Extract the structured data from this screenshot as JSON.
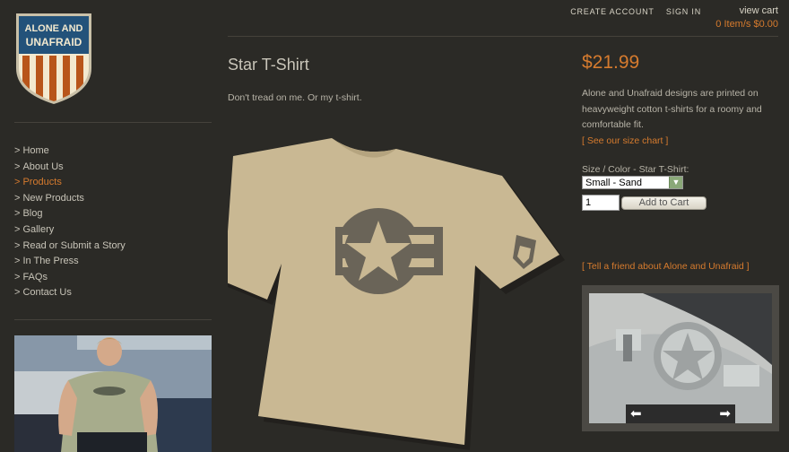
{
  "header": {
    "create_account": "CREATE ACCOUNT",
    "sign_in": "SIGN IN",
    "view_cart": "view cart",
    "cart_summary": "0 Item/s $0.00"
  },
  "logo": {
    "line1": "ALONE AND",
    "line2": "UNAFRAID",
    "colors": {
      "blue": "#23527a",
      "orange": "#b8551a",
      "cream": "#f3e9cf"
    }
  },
  "nav": [
    {
      "label": "Home",
      "active": false
    },
    {
      "label": "About Us",
      "active": false
    },
    {
      "label": "Products",
      "active": true
    },
    {
      "label": "New Products",
      "active": false
    },
    {
      "label": "Blog",
      "active": false
    },
    {
      "label": "Gallery",
      "active": false
    },
    {
      "label": "Read or Submit a Story",
      "active": false
    },
    {
      "label": "In The Press",
      "active": false
    },
    {
      "label": "FAQs",
      "active": false
    },
    {
      "label": "Contact Us",
      "active": false
    }
  ],
  "product": {
    "title": "Star T-Shirt",
    "tagline": "Don't tread on me. Or my t-shirt.",
    "price": "$21.99",
    "description": "Alone and Unafraid designs are printed on heavyweight cotton t-shirts for a roomy and comfortable fit.",
    "size_chart_link": "[ See our size chart ]",
    "select_label": "Size / Color - Star T-Shirt:",
    "selected_option": "Small - Sand",
    "quantity": "1",
    "add_to_cart": "Add to Cart",
    "tell_friend": "[ Tell a friend about Alone and Unafraid ]"
  },
  "icons": {
    "prev": "left-arrow-icon",
    "next": "right-arrow-icon",
    "dropdown": "chevron-down-icon"
  },
  "colors": {
    "background": "#2b2a26",
    "accent": "#d67b2e",
    "shirt": "#c9b893",
    "print": "#6a6458"
  }
}
